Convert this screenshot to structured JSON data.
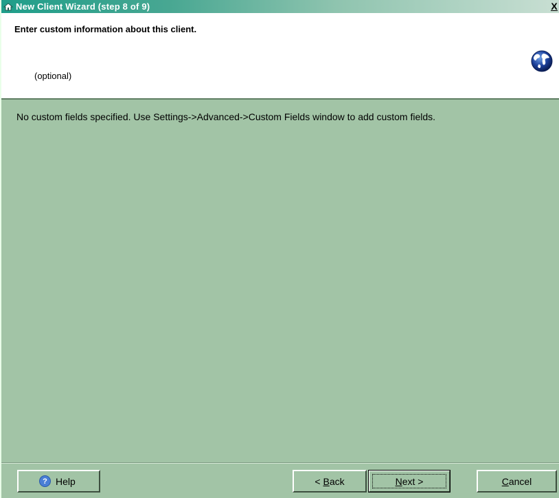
{
  "window": {
    "title": "New Client Wizard  (step 8 of 9)",
    "close_label": "X"
  },
  "header": {
    "title": "Enter custom information about this client.",
    "subtitle": "(optional)"
  },
  "main": {
    "message": "No custom fields specified. Use Settings->Advanced->Custom Fields window to add custom fields."
  },
  "footer": {
    "help_label": "Help",
    "back_prefix": "< ",
    "back_mnemonic": "B",
    "back_rest": "ack",
    "next_mnemonic": "N",
    "next_rest": "ext >",
    "cancel_mnemonic": "C",
    "cancel_rest": "ancel"
  },
  "colors": {
    "background": "#a2c4a6",
    "title_gradient_start": "#1f9e8a",
    "header_bg": "#ffffff"
  }
}
